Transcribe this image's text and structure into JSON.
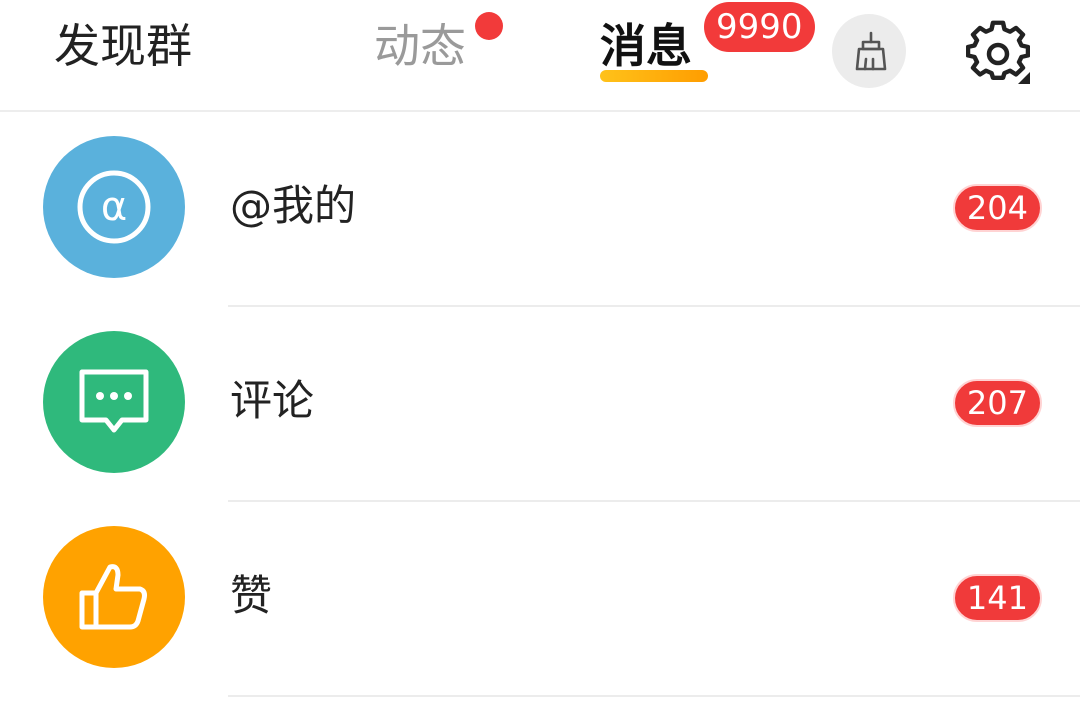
{
  "header": {
    "tabs": [
      {
        "label": "发现群",
        "active": false
      },
      {
        "label": "动态",
        "active": false,
        "has_dot": true
      },
      {
        "label": "消息",
        "active": true
      }
    ],
    "messages_badge": "9990",
    "clean_icon": "broom-icon",
    "settings_icon": "gear-icon"
  },
  "items": [
    {
      "label": "@我的",
      "count": "204",
      "icon": "at-sign-icon",
      "color": "#5ab1dc"
    },
    {
      "label": "评论",
      "count": "207",
      "icon": "comment-bubble-icon",
      "color": "#2fb97c"
    },
    {
      "label": "赞",
      "count": "141",
      "icon": "thumbs-up-icon",
      "color": "#ffa200"
    }
  ],
  "colors": {
    "badge": "#f23a3a",
    "accent_underline": "#ffb300",
    "inactive_tab": "#9a9a9a"
  }
}
